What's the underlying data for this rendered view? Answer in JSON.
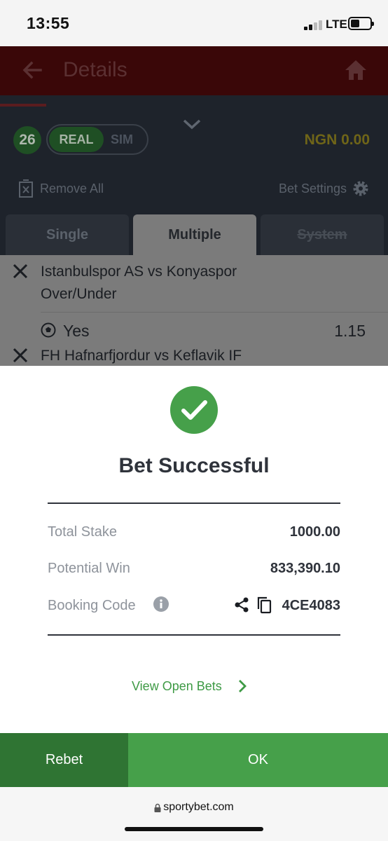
{
  "status_bar": {
    "time": "13:55",
    "network": "LTE",
    "battery_level": 0.45
  },
  "header": {
    "title": "Details"
  },
  "betslip": {
    "selection_count": "26",
    "mode_real": "REAL",
    "mode_sim": "SIM",
    "balance": "NGN 0.00",
    "remove_all": "Remove All",
    "bet_settings": "Bet Settings",
    "tabs": [
      {
        "label": "Single"
      },
      {
        "label": "Multiple"
      },
      {
        "label": "System"
      }
    ],
    "selections": [
      {
        "match": "Istanbulspor AS vs Konyaspor",
        "market": "Over/Under",
        "pick": "Yes",
        "odds": "1.15"
      },
      {
        "match": "FH Hafnarfjordur vs Keflavik IF"
      }
    ]
  },
  "dialog": {
    "title": "Bet Successful",
    "total_stake_label": "Total Stake",
    "total_stake_value": "1000.00",
    "potential_win_label": "Potential Win",
    "potential_win_value": "833,390.10",
    "booking_code_label": "Booking Code",
    "booking_code_value": "4CE4083",
    "view_open_bets": "View Open Bets"
  },
  "buttons": {
    "rebet": "Rebet",
    "ok": "OK"
  },
  "browser": {
    "url": "sportybet.com"
  },
  "colors": {
    "brand_green": "#46a04a",
    "dark_green": "#2f7433",
    "header_red": "#3a0708"
  }
}
